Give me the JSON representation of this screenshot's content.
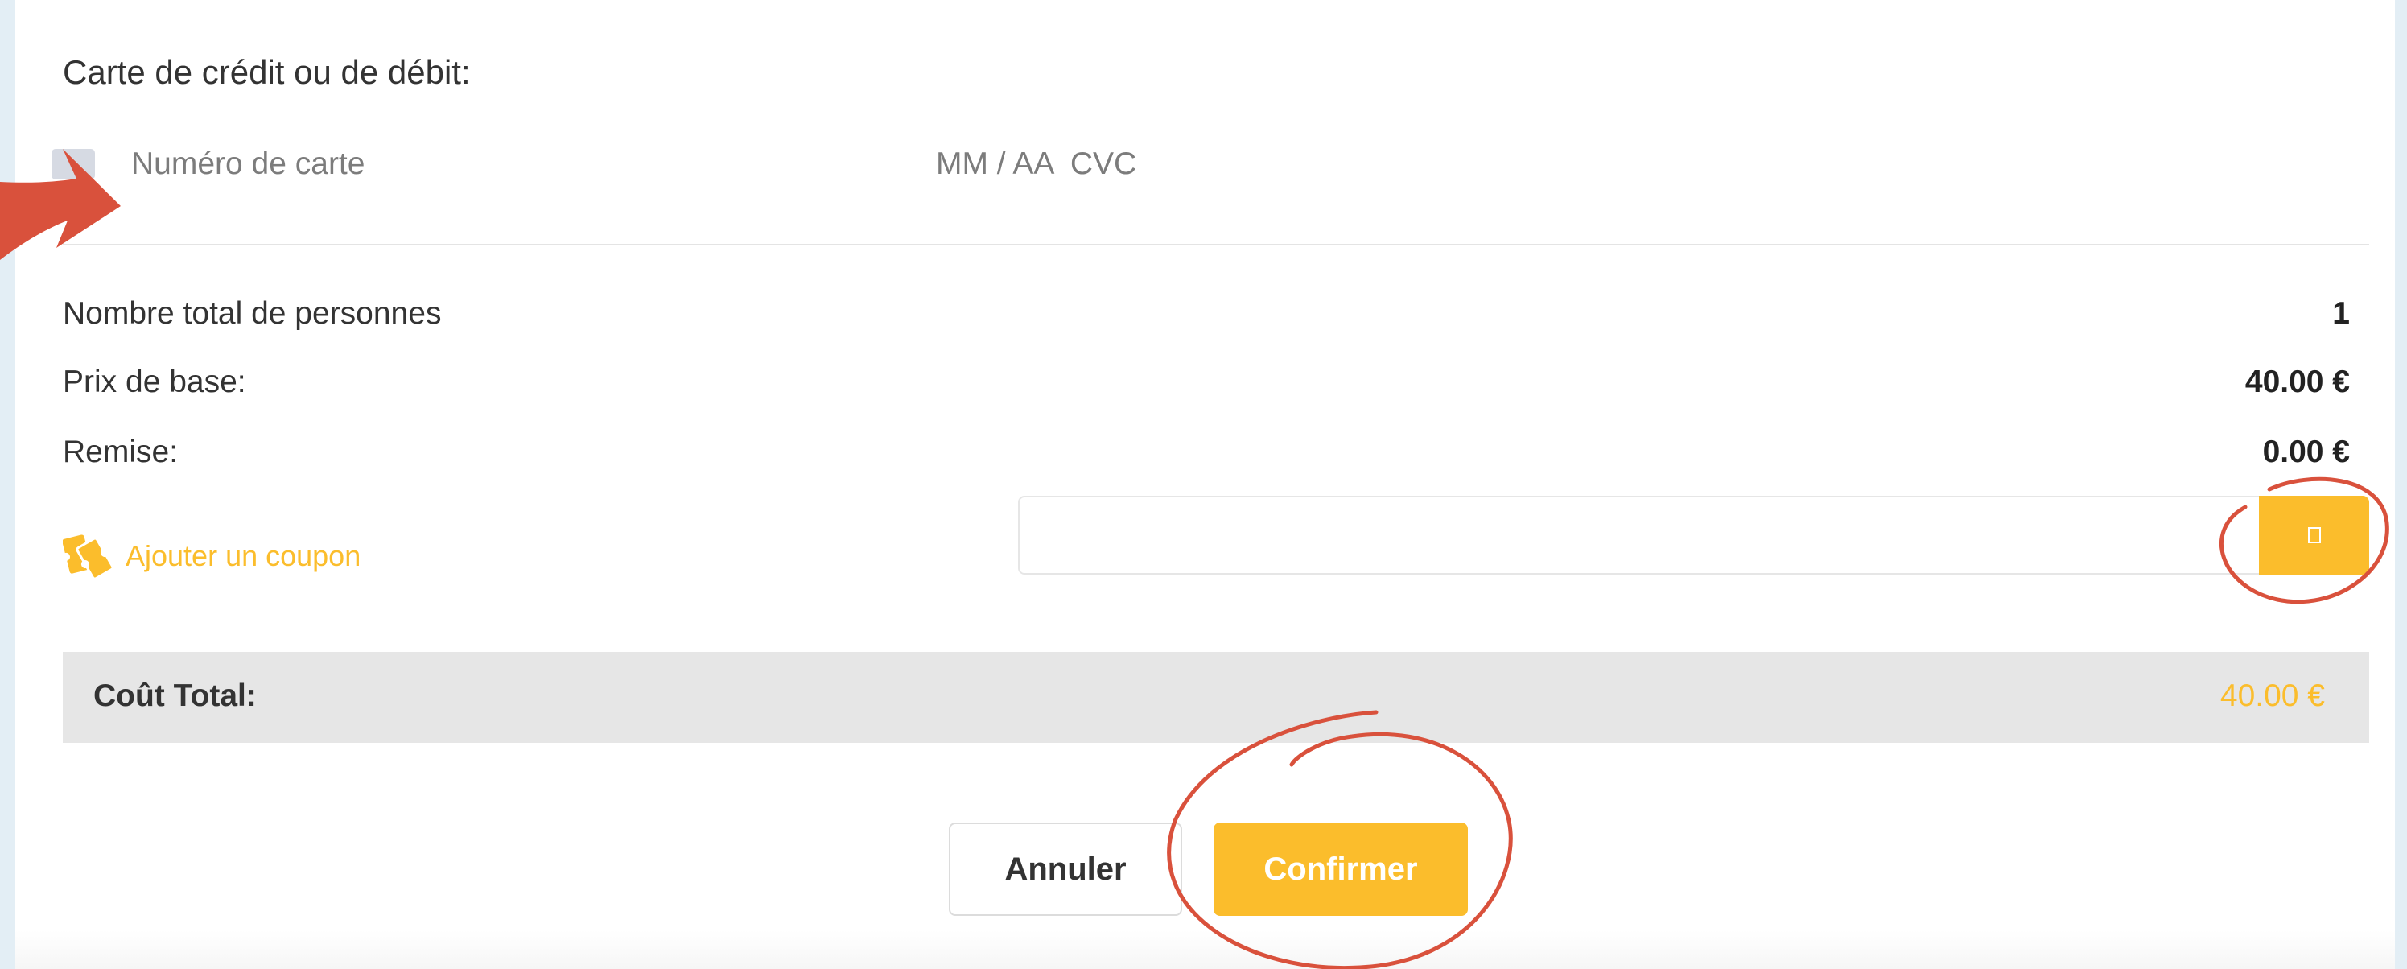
{
  "payment": {
    "heading": "Carte de crédit ou de débit:",
    "card_number_placeholder": "Numéro de carte",
    "expiry_cvc_placeholder": "MM / AA  CVC"
  },
  "summary": {
    "people_label": "Nombre total de personnes",
    "people_value": "1",
    "base_price_label": "Prix de base:",
    "base_price_value": "40.00 €",
    "discount_label": "Remise:",
    "discount_value": "0.00 €"
  },
  "coupon": {
    "link_label": "Ajouter un coupon",
    "input_value": "",
    "input_placeholder": "",
    "submit_icon": "missing-glyph-icon"
  },
  "total": {
    "label": "Coût Total:",
    "value": "40.00 €"
  },
  "actions": {
    "cancel_label": "Annuler",
    "confirm_label": "Confirmer"
  },
  "colors": {
    "accent": "#fbbd2c",
    "annotation": "#d9513c",
    "total_bar": "#e6e6e6",
    "page_background": "#e3eef5"
  }
}
